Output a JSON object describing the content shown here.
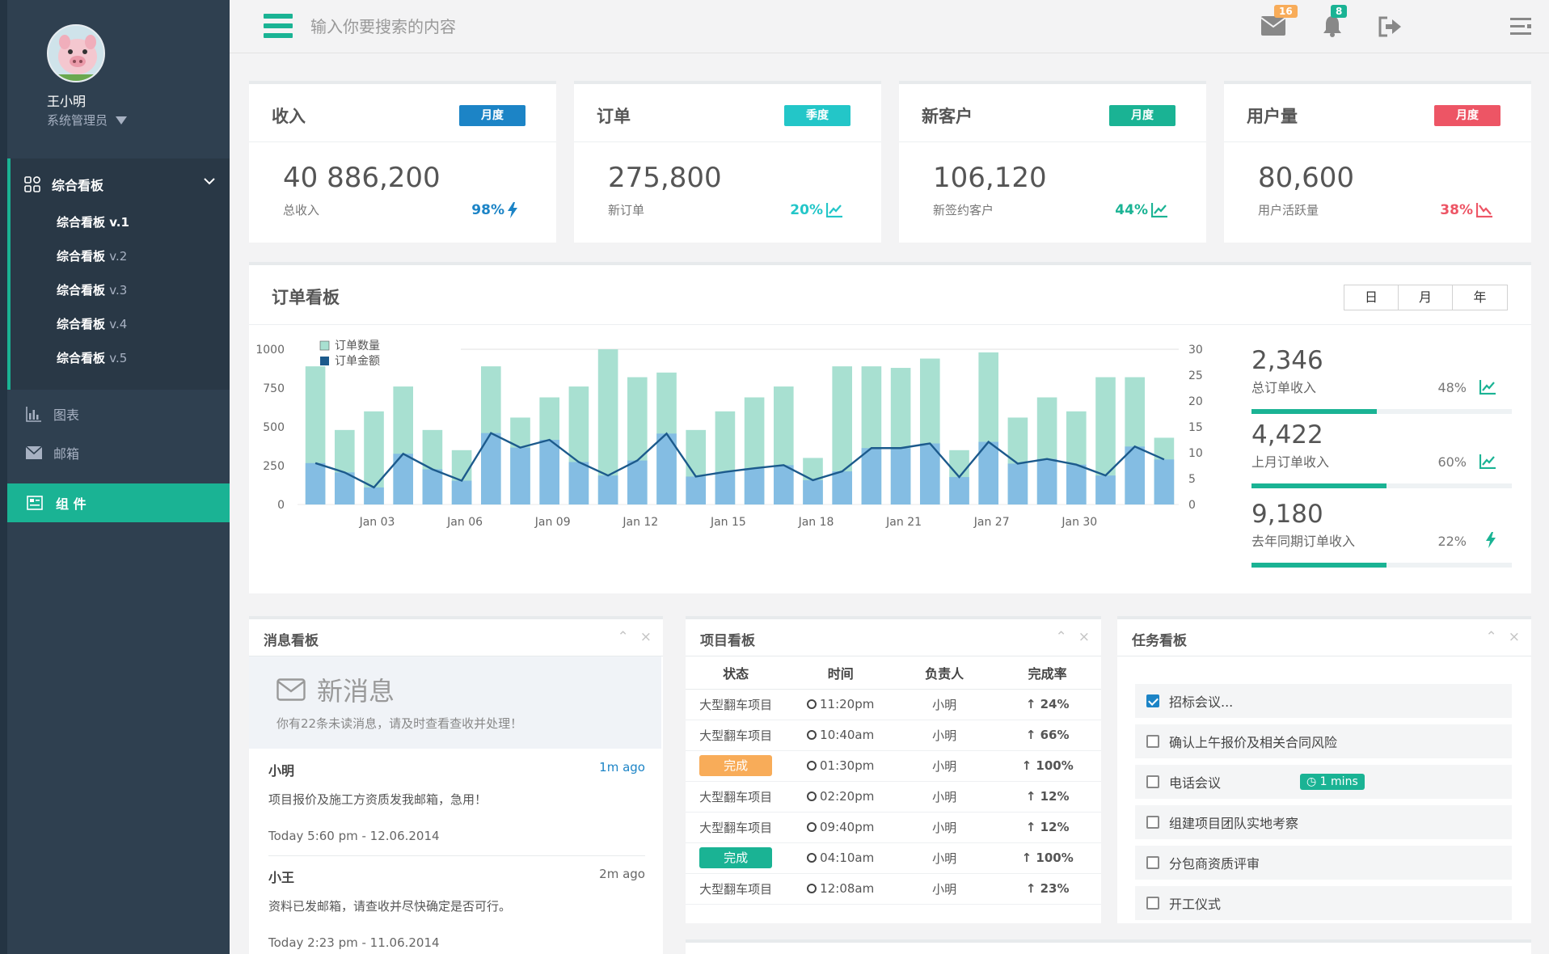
{
  "user": {
    "name": "王小明",
    "role": "系统管理员"
  },
  "nav": {
    "dashboard_label": "综合看板",
    "dashboard_subs": [
      {
        "name": "综合看板",
        "ver": "v.1"
      },
      {
        "name": "综合看板",
        "ver": "v.2"
      },
      {
        "name": "综合看板",
        "ver": "v.3"
      },
      {
        "name": "综合看板",
        "ver": "v.4"
      },
      {
        "name": "综合看板",
        "ver": "v.5"
      }
    ],
    "charts_label": "图表",
    "mail_label": "邮箱",
    "widgets_label": "组 件"
  },
  "topbar": {
    "search_placeholder": "输入你要搜索的内容",
    "mail_count": "16",
    "bell_count": "8",
    "logout_label": "退出"
  },
  "cards": [
    {
      "title": "收入",
      "label": "月度",
      "value": "40 886,200",
      "sub": "总收入",
      "pct": "98%",
      "color": "#1c84c6",
      "label_color": "#1c84c6"
    },
    {
      "title": "订单",
      "label": "季度",
      "value": "275,800",
      "sub": "新订单",
      "pct": "20%",
      "color": "#23c6c8",
      "label_color": "#23c6c8"
    },
    {
      "title": "新客户",
      "label": "月度",
      "value": "106,120",
      "sub": "新签约客户",
      "pct": "44%",
      "color": "#1ab394",
      "label_color": "#1ab394"
    },
    {
      "title": "用户量",
      "label": "月度",
      "value": "80,600",
      "sub": "用户活跃量",
      "pct": "38%",
      "color": "#ed5565",
      "label_color": "#ed5565"
    }
  ],
  "orders_board": {
    "title": "订单看板",
    "range_buttons": [
      "日",
      "月",
      "年"
    ],
    "stats": [
      {
        "value": "2,346",
        "label": "总订单收入",
        "pct": "48%",
        "progress": 0.48
      },
      {
        "value": "4,422",
        "label": "上月订单收入",
        "pct": "60%",
        "progress": 0.52
      },
      {
        "value": "9,180",
        "label": "去年同期订单收入",
        "pct": "22%",
        "progress": 0.52
      }
    ]
  },
  "chart_data": {
    "type": "bar",
    "legend": [
      "订单数量",
      "订单金额"
    ],
    "x_ticks": [
      "Jan 03",
      "Jan 06",
      "Jan 09",
      "Jan 12",
      "Jan 15",
      "Jan 18",
      "Jan 21",
      "Jan 27",
      "Jan 30"
    ],
    "y_left": {
      "ticks": [
        0,
        250,
        500,
        750,
        1000
      ],
      "range": [
        0,
        1000
      ]
    },
    "y_right": {
      "ticks": [
        0,
        5,
        10,
        15,
        20,
        25,
        30
      ],
      "range": [
        0,
        30
      ]
    },
    "series": [
      {
        "name": "订单数量",
        "type": "bar",
        "axis": "left",
        "color": "#a8e0d1",
        "values": [
          890,
          480,
          600,
          760,
          480,
          350,
          890,
          560,
          690,
          760,
          1000,
          820,
          850,
          480,
          600,
          690,
          760,
          300,
          890,
          890,
          880,
          940,
          350,
          980,
          560,
          690,
          600,
          820,
          820,
          430
        ]
      },
      {
        "name": "订单金额",
        "type": "bar-line",
        "axis": "right",
        "color": "#7eb6e6",
        "line_color": "#1c5a8c",
        "values": [
          8.0,
          6.2,
          3.3,
          9.8,
          6.8,
          4.6,
          13.8,
          11.0,
          12.5,
          8.2,
          5.6,
          8.5,
          13.7,
          5.4,
          6.3,
          7.0,
          7.6,
          4.7,
          6.4,
          10.9,
          10.9,
          11.8,
          5.3,
          12.1,
          7.9,
          8.8,
          7.7,
          5.6,
          11.2,
          8.7
        ]
      }
    ]
  },
  "messages": {
    "title": "消息看板",
    "banner_title": "新消息",
    "banner_note": "你有22条未读消息，请及时查看查收并处理！",
    "items": [
      {
        "name": "小明",
        "ago": "1m ago",
        "body": "项目报价及施工方资质发我邮箱，急用！",
        "time": "Today 5:60 pm - 12.06.2014",
        "ago_color": "#1c84c6"
      },
      {
        "name": "小王",
        "ago": "2m ago",
        "body": "资料已发邮箱，请查收并尽快确定是否可行。",
        "time": "Today 2:23 pm - 11.06.2014",
        "ago_color": "#666666"
      }
    ]
  },
  "projects": {
    "title": "项目看板",
    "headers": [
      "状态",
      "时间",
      "负责人",
      "完成率"
    ],
    "rows": [
      {
        "status": "大型翻车项目",
        "badge": "",
        "time": "11:20pm",
        "owner": "小明",
        "rate": "24%"
      },
      {
        "status": "大型翻车项目",
        "badge": "",
        "time": "10:40am",
        "owner": "小明",
        "rate": "66%"
      },
      {
        "status": "完成",
        "badge": "#f8ac59",
        "time": "01:30pm",
        "owner": "小明",
        "rate": "100%"
      },
      {
        "status": "大型翻车项目",
        "badge": "",
        "time": "02:20pm",
        "owner": "小明",
        "rate": "12%"
      },
      {
        "status": "大型翻车项目",
        "badge": "",
        "time": "09:40pm",
        "owner": "小明",
        "rate": "12%"
      },
      {
        "status": "完成",
        "badge": "#1ab394",
        "time": "04:10am",
        "owner": "小明",
        "rate": "100%"
      },
      {
        "status": "大型翻车项目",
        "badge": "",
        "time": "12:08am",
        "owner": "小明",
        "rate": "23%"
      }
    ]
  },
  "tasks": {
    "title": "任务看板",
    "items": [
      {
        "text": "招标会议...",
        "checked": true,
        "tag": ""
      },
      {
        "text": "确认上午报价及相关合同风险",
        "checked": false,
        "tag": ""
      },
      {
        "text": "电话会议",
        "checked": false,
        "tag": "1 mins"
      },
      {
        "text": "组建项目团队实地考察",
        "checked": false,
        "tag": ""
      },
      {
        "text": "分包商资质评审",
        "checked": false,
        "tag": ""
      },
      {
        "text": "开工仪式",
        "checked": false,
        "tag": ""
      }
    ]
  },
  "colors": {
    "accent": "#1ab394",
    "sidebar": "#2f4050",
    "blue": "#1c84c6",
    "red": "#ed5565",
    "orange": "#f8ac59"
  }
}
